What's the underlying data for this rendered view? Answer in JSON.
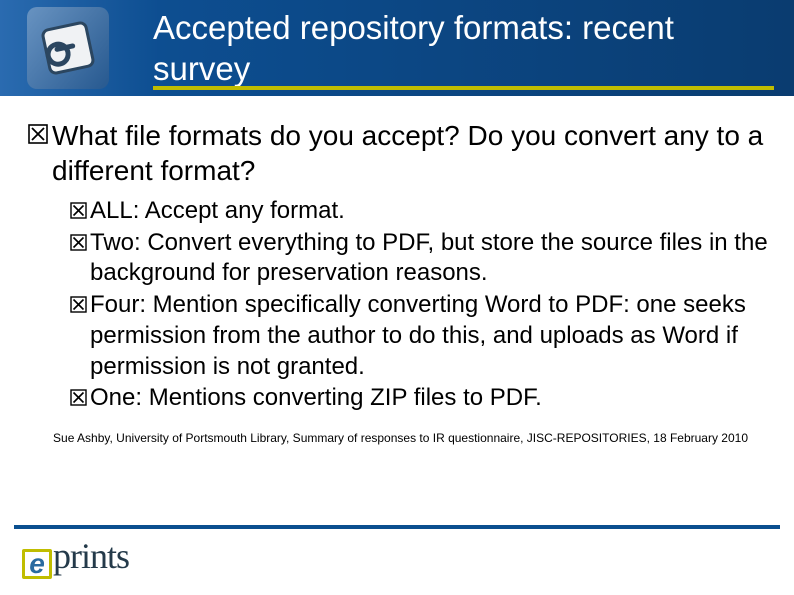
{
  "header": {
    "title": "Accepted repository formats: recent survey"
  },
  "question": "What file formats do you accept? Do you convert any to a different format?",
  "answers": [
    "ALL: Accept any format.",
    "Two: Convert everything to PDF, but store the source files in the background for preservation reasons.",
    "Four: Mention specifically converting Word to PDF: one seeks permission from the author to do this, and uploads as Word if permission is not granted.",
    "One: Mentions converting ZIP files to PDF."
  ],
  "citation": "Sue Ashby, University of Portsmouth Library, Summary of responses to IR questionnaire, JISC-REPOSITORIES, 18 February 2010",
  "footer": {
    "logo_e": "e",
    "logo_text": "prints"
  }
}
